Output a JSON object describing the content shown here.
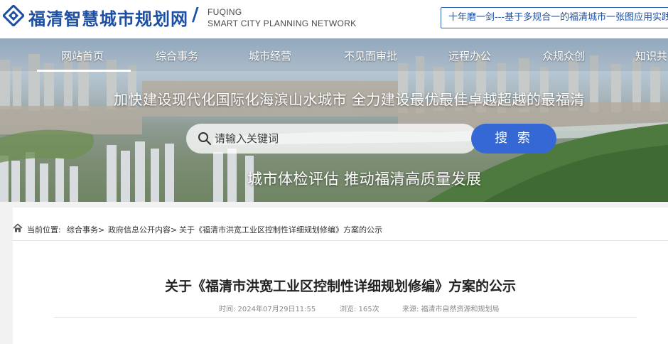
{
  "header": {
    "title": "福清智慧城市规划网",
    "slash": "/",
    "title_en_line1": "FUQING",
    "title_en_line2": "SMART CITY PLANNING NETWORK",
    "ticker": "十年磨一剑---基于多规合一的福清城市一张图应用实践"
  },
  "nav": {
    "items": [
      {
        "label": "网站首页"
      },
      {
        "label": "综合事务"
      },
      {
        "label": "城市经营"
      },
      {
        "label": "不见面审批"
      },
      {
        "label": "远程办公"
      },
      {
        "label": "众规众创"
      },
      {
        "label": "知识共"
      }
    ]
  },
  "banner": {
    "slogan1": "加快建设现代化国际化海滨山水城市 全力建设最优最佳卓越超越的最福清",
    "slogan2": "城市体检评估 推动福清高质量发展"
  },
  "search": {
    "placeholder": "请输入关键词",
    "button": "搜 索"
  },
  "breadcrumb": {
    "prefix": "当前位置:",
    "item1": "综合事务>",
    "item2": "政府信息公开内容>",
    "item3": "关于《福清市洪宽工业区控制性详细规划修编》方案的公示"
  },
  "article": {
    "title": "关于《福清市洪宽工业区控制性详细规划修编》方案的公示",
    "time": "时间: 2024年07月29日11:55",
    "views": "浏览: 165次",
    "source": "来源: 福清市自然资源和规划局"
  },
  "colors": {
    "brand": "#1d4fa3",
    "button": "#3568d4"
  }
}
